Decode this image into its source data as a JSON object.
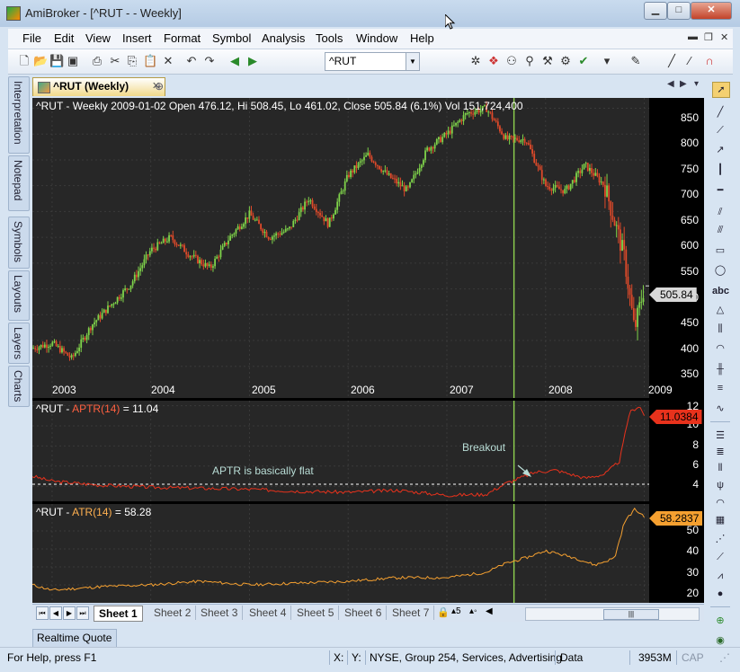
{
  "window": {
    "title": "AmiBroker - [^RUT -  - Weekly]",
    "min": "▁",
    "max": "□",
    "close": "✕"
  },
  "menu": [
    "File",
    "Edit",
    "View",
    "Insert",
    "Format",
    "Symbol",
    "Analysis",
    "Tools",
    "Window",
    "Help"
  ],
  "toolbar": {
    "symbol": "^RUT"
  },
  "left_tabs": [
    "Interpretation",
    "Notepad",
    "Symbols",
    "Layouts",
    "Layers",
    "Charts"
  ],
  "doc_tab": {
    "label": "^RUT (Weekly)"
  },
  "price_pane": {
    "title": "^RUT - Weekly 2009-01-02 Open 476.12, Hi 508.45, Lo 461.02, Close 505.84 (6.1%) Vol 151,724,400",
    "yticks": [
      "850",
      "800",
      "750",
      "700",
      "650",
      "600",
      "550",
      "500",
      "450",
      "400",
      "350"
    ],
    "last_label": "505.84",
    "xticks": [
      "2003",
      "2004",
      "2005",
      "2006",
      "2007",
      "2008",
      "2009"
    ]
  },
  "aptr_pane": {
    "symbol": "^RUT - ",
    "name": "APTR(14)",
    "value": " = 11.04",
    "yticks": [
      "12",
      "10",
      "8",
      "6",
      "4"
    ],
    "last_label": "11.0384",
    "annot_flat": "APTR is basically flat",
    "annot_breakout": "Breakout",
    "line_color": "#e8321c",
    "level": 4.2
  },
  "atr_pane": {
    "symbol": "^RUT - ",
    "name": "ATR(14)",
    "value": " = 58.28",
    "yticks": [
      "50",
      "40",
      "30",
      "20"
    ],
    "last_label": "58.2837",
    "line_color": "#f5a030"
  },
  "chart_data": [
    {
      "type": "candlestick",
      "title": "^RUT - Weekly",
      "x_range": [
        "2002-11",
        "2009-01"
      ],
      "ylim": [
        320,
        870
      ],
      "path_points": [
        [
          2002.8,
          385
        ],
        [
          2003.0,
          395
        ],
        [
          2003.2,
          365
        ],
        [
          2003.4,
          430
        ],
        [
          2003.6,
          470
        ],
        [
          2003.8,
          510
        ],
        [
          2004.0,
          575
        ],
        [
          2004.2,
          600
        ],
        [
          2004.4,
          565
        ],
        [
          2004.6,
          540
        ],
        [
          2004.8,
          600
        ],
        [
          2005.0,
          645
        ],
        [
          2005.2,
          600
        ],
        [
          2005.4,
          615
        ],
        [
          2005.6,
          675
        ],
        [
          2005.8,
          625
        ],
        [
          2006.0,
          720
        ],
        [
          2006.2,
          760
        ],
        [
          2006.4,
          720
        ],
        [
          2006.6,
          690
        ],
        [
          2006.8,
          770
        ],
        [
          2007.0,
          800
        ],
        [
          2007.2,
          840
        ],
        [
          2007.4,
          850
        ],
        [
          2007.6,
          790
        ],
        [
          2007.8,
          790
        ],
        [
          2008.0,
          700
        ],
        [
          2008.2,
          690
        ],
        [
          2008.4,
          740
        ],
        [
          2008.6,
          700
        ],
        [
          2008.8,
          560
        ],
        [
          2008.9,
          420
        ],
        [
          2009.0,
          505
        ]
      ],
      "xlabels": [
        "2003",
        "2004",
        "2005",
        "2006",
        "2007",
        "2008",
        "2009"
      ]
    },
    {
      "type": "line",
      "title": "APTR(14)",
      "ylim": [
        2.5,
        12.5
      ],
      "reference_level": 4.2,
      "points": [
        [
          2002.8,
          5.0
        ],
        [
          2003.0,
          4.5
        ],
        [
          2003.5,
          4.1
        ],
        [
          2004.0,
          3.9
        ],
        [
          2004.5,
          3.8
        ],
        [
          2005.0,
          3.7
        ],
        [
          2005.5,
          3.5
        ],
        [
          2006.0,
          3.4
        ],
        [
          2006.5,
          3.6
        ],
        [
          2007.0,
          3.1
        ],
        [
          2007.4,
          3.2
        ],
        [
          2007.6,
          4.3
        ],
        [
          2007.9,
          5.4
        ],
        [
          2008.1,
          5.6
        ],
        [
          2008.4,
          4.8
        ],
        [
          2008.6,
          5.2
        ],
        [
          2008.75,
          6.5
        ],
        [
          2008.85,
          11.3
        ],
        [
          2008.95,
          12.0
        ],
        [
          2009.0,
          11.04
        ]
      ]
    },
    {
      "type": "line",
      "title": "ATR(14)",
      "ylim": [
        10,
        65
      ],
      "points": [
        [
          2002.8,
          20
        ],
        [
          2003.0,
          17
        ],
        [
          2003.5,
          19
        ],
        [
          2004.0,
          20
        ],
        [
          2004.5,
          22
        ],
        [
          2005.0,
          20
        ],
        [
          2005.5,
          21
        ],
        [
          2006.0,
          22
        ],
        [
          2006.5,
          24
        ],
        [
          2007.0,
          24
        ],
        [
          2007.4,
          27
        ],
        [
          2007.6,
          32
        ],
        [
          2007.8,
          35
        ],
        [
          2008.0,
          39
        ],
        [
          2008.3,
          35
        ],
        [
          2008.5,
          31
        ],
        [
          2008.7,
          35
        ],
        [
          2008.8,
          55
        ],
        [
          2008.9,
          62
        ],
        [
          2009.0,
          58.28
        ]
      ]
    }
  ],
  "sheets": [
    "Sheet 1",
    "Sheet 2",
    "Sheet 3",
    "Sheet 4",
    "Sheet 5",
    "Sheet 6",
    "Sheet 7"
  ],
  "realtime_tab": "Realtime Quote",
  "status": {
    "help": "For Help, press F1",
    "x": "X:",
    "y": "Y:",
    "info": "NYSE, Group 254, Services, Advertising",
    "data": "Data",
    "mem": "3953M",
    "cap": "CAP"
  }
}
